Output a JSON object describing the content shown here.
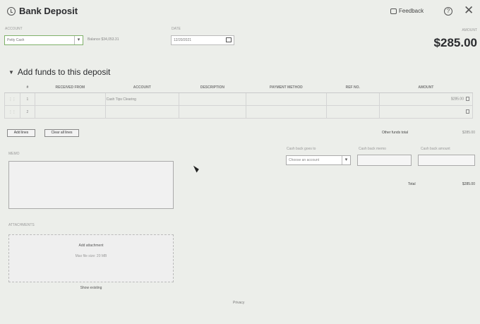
{
  "header": {
    "title": "Bank Deposit",
    "feedback": "Feedback",
    "help": "?",
    "close": "✕"
  },
  "form": {
    "account_label": "Account",
    "account_value": "Petty Cash",
    "balance": "Balance $34,053.31",
    "date_label": "Date",
    "date_value": "12/20/2021",
    "amount_label": "Amount",
    "amount_value": "$285.00"
  },
  "section": {
    "title": "Add funds to this deposit"
  },
  "grid": {
    "columns": [
      "#",
      "Received from",
      "Account",
      "Description",
      "Payment method",
      "Ref no.",
      "Amount"
    ],
    "rows": [
      {
        "num": "1",
        "received_from": "",
        "account": "Cash Tips Clearing",
        "description": "",
        "payment_method": "",
        "ref_no": "",
        "amount": "$285.00"
      },
      {
        "num": "2",
        "received_from": "",
        "account": "",
        "description": "",
        "payment_method": "",
        "ref_no": "",
        "amount": ""
      }
    ]
  },
  "buttons": {
    "add_lines": "Add lines",
    "clear_all_lines": "Clear all lines"
  },
  "other_funds": {
    "label": "Other funds total",
    "value": "$285.00"
  },
  "cash_back": {
    "goes_to_label": "Cash back goes to",
    "goes_to_placeholder": "Choose an account",
    "memo_label": "Cash back memo",
    "amount_label": "Cash back amount"
  },
  "memo": {
    "label": "Memo"
  },
  "total": {
    "label": "Total",
    "value": "$285.00"
  },
  "attachments": {
    "label": "Attachments",
    "add": "Add attachment",
    "max_size": "Max file size: 20 MB",
    "show_existing": "Show existing"
  },
  "footer": {
    "privacy": "Privacy"
  }
}
